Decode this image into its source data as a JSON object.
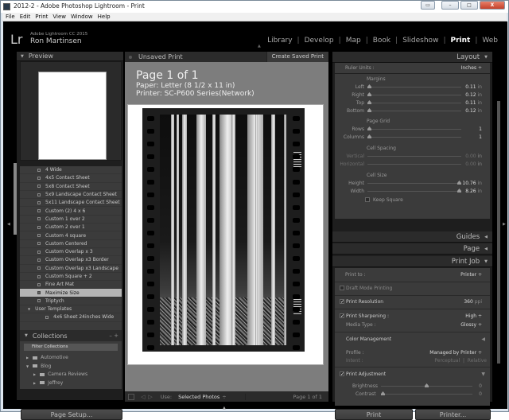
{
  "window": {
    "title": "2012-2 - Adobe Photoshop Lightroom - Print",
    "controls": {
      "minimize": "–",
      "maximize": "□",
      "close": "X"
    }
  },
  "menubar": [
    "File",
    "Edit",
    "Print",
    "View",
    "Window",
    "Help"
  ],
  "identity_plate": {
    "logo": "Lr",
    "product": "Adobe Lightroom CC 2015",
    "user": "Ron Martinsen"
  },
  "modules": [
    {
      "label": "Library",
      "active": false
    },
    {
      "label": "Develop",
      "active": false
    },
    {
      "label": "Map",
      "active": false
    },
    {
      "label": "Book",
      "active": false
    },
    {
      "label": "Slideshow",
      "active": false
    },
    {
      "label": "Print",
      "active": true
    },
    {
      "label": "Web",
      "active": false
    }
  ],
  "left_panel": {
    "preview_title": "Preview",
    "templates": [
      {
        "label": "4 Wide",
        "type": "item"
      },
      {
        "label": "4x5 Contact Sheet",
        "type": "item"
      },
      {
        "label": "5x8 Contact Sheet",
        "type": "item"
      },
      {
        "label": "5x9 Landscape Contact Sheet",
        "type": "item"
      },
      {
        "label": "5x11 Landscape Contact Sheet",
        "type": "item"
      },
      {
        "label": "Custom (2) 4 x 6",
        "type": "item"
      },
      {
        "label": "Custom 1 over 2",
        "type": "item"
      },
      {
        "label": "Custom 2 over 1",
        "type": "item"
      },
      {
        "label": "Custom 4 square",
        "type": "item"
      },
      {
        "label": "Custom Centered",
        "type": "item"
      },
      {
        "label": "Custom Overlap x 3",
        "type": "item"
      },
      {
        "label": "Custom Overlap x3 Border",
        "type": "item"
      },
      {
        "label": "Custom Overlap x3 Landscape",
        "type": "item"
      },
      {
        "label": "Custom Square + 2",
        "type": "item"
      },
      {
        "label": "Fine Art Mat",
        "type": "item"
      },
      {
        "label": "Maximize Size",
        "type": "item",
        "selected": true
      },
      {
        "label": "Triptych",
        "type": "item"
      },
      {
        "label": "User Templates",
        "type": "folder"
      },
      {
        "label": "4x6 Sheet 24inches Wide",
        "type": "item"
      }
    ],
    "collections_title": "Collections",
    "collections_controls": "– +",
    "filter_label": "Filter Collections",
    "collections": [
      {
        "label": "Automotive",
        "level": 0,
        "expanded": false
      },
      {
        "label": "Blog",
        "level": 0,
        "expanded": true
      },
      {
        "label": "Camera Reviews",
        "level": 1,
        "expanded": false
      },
      {
        "label": "Jeffrey",
        "level": 1,
        "expanded": false
      }
    ],
    "page_setup_label": "Page Setup..."
  },
  "center": {
    "print_name": "Unsaved Print",
    "create_saved_label": "Create Saved Print",
    "page_title": "Page 1 of 1",
    "paper": "Paper:  Letter (8 1/2 x 11 in)",
    "printer": "Printer:  SC-P600 Series(Network)",
    "toolbar": {
      "use_label": "Use:",
      "use_value": "Selected Photos",
      "page_indicator": "Page 1 of 1"
    }
  },
  "right_panel": {
    "layout": {
      "title": "Layout",
      "ruler_units_label": "Ruler Units :",
      "ruler_units_value": "Inches",
      "margins_title": "Margins",
      "margins": [
        {
          "label": "Left",
          "value": "0.11",
          "unit": "in",
          "fraction": 0.0
        },
        {
          "label": "Right",
          "value": "0.12",
          "unit": "in",
          "fraction": 0.0
        },
        {
          "label": "Top",
          "value": "0.11",
          "unit": "in",
          "fraction": 0.0
        },
        {
          "label": "Bottom",
          "value": "0.12",
          "unit": "in",
          "fraction": 0.0
        }
      ],
      "page_grid_title": "Page Grid",
      "page_grid": [
        {
          "label": "Rows",
          "value": "1",
          "fraction": 0.0
        },
        {
          "label": "Columns",
          "value": "1",
          "fraction": 0.0
        }
      ],
      "cell_spacing_title": "Cell Spacing",
      "cell_spacing": [
        {
          "label": "Vertical",
          "value": "0.00",
          "unit": "in"
        },
        {
          "label": "Horizontal",
          "value": "0.00",
          "unit": "in"
        }
      ],
      "cell_size_title": "Cell Size",
      "cell_size": [
        {
          "label": "Height",
          "value": "10.76",
          "unit": "in",
          "fraction": 1.0
        },
        {
          "label": "Width",
          "value": "8.26",
          "unit": "in",
          "fraction": 1.0
        }
      ],
      "keep_square_label": "Keep Square",
      "keep_square_checked": false
    },
    "guides_title": "Guides",
    "page_title": "Page",
    "print_job": {
      "title": "Print Job",
      "print_to_label": "Print to :",
      "print_to_value": "Printer",
      "draft_mode_label": "Draft Mode Printing",
      "draft_mode_checked": false,
      "print_resolution_label": "Print Resolution",
      "print_resolution_checked": true,
      "print_resolution_value": "360",
      "print_resolution_unit": "ppi",
      "print_sharpening_label": "Print Sharpening :",
      "print_sharpening_checked": true,
      "print_sharpening_value": "High",
      "media_type_label": "Media Type :",
      "media_type_value": "Glossy",
      "color_management_title": "Color Management",
      "profile_label": "Profile :",
      "profile_value": "Managed by Printer",
      "intent_label": "Intent :",
      "intent_options": [
        "Perceptual",
        "Relative"
      ],
      "print_adjustment_label": "Print Adjustment",
      "print_adjustment_checked": true,
      "brightness_label": "Brightness",
      "brightness_value": "0",
      "brightness_fraction": 0.5,
      "contrast_label": "Contrast",
      "contrast_value": "0",
      "contrast_fraction": 0.0
    },
    "print_label": "Print",
    "printer_label": "Printer..."
  }
}
